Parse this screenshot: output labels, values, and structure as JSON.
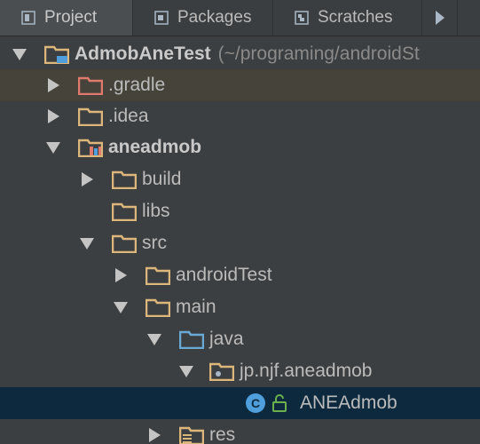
{
  "tabs": [
    {
      "label": "Project",
      "icon": "project-icon",
      "active": true
    },
    {
      "label": "Packages",
      "icon": "packages-icon",
      "active": false
    },
    {
      "label": "Scratches",
      "icon": "scratches-icon",
      "active": false
    }
  ],
  "tree": {
    "root": {
      "label": "AdmobAneTest",
      "path": "(~/programing/androidSt"
    },
    "items": [
      {
        "label": ".gradle"
      },
      {
        "label": ".idea"
      },
      {
        "label": "aneadmob"
      },
      {
        "label": "build"
      },
      {
        "label": "libs"
      },
      {
        "label": "src"
      },
      {
        "label": "androidTest"
      },
      {
        "label": "main"
      },
      {
        "label": "java"
      },
      {
        "label": "jp.njf.aneadmob"
      },
      {
        "label": "ANEAdmob",
        "icon_letter": "C"
      },
      {
        "label": "res"
      }
    ]
  },
  "colors": {
    "panel_background": "#3c3f41",
    "selection": "#0d293e",
    "highlight_row": "#46433b",
    "folder": "#dcb67a",
    "excluded_folder": "#e07a6c",
    "source_folder": "#6aa9d6",
    "class_icon": "#4f9fdc"
  }
}
